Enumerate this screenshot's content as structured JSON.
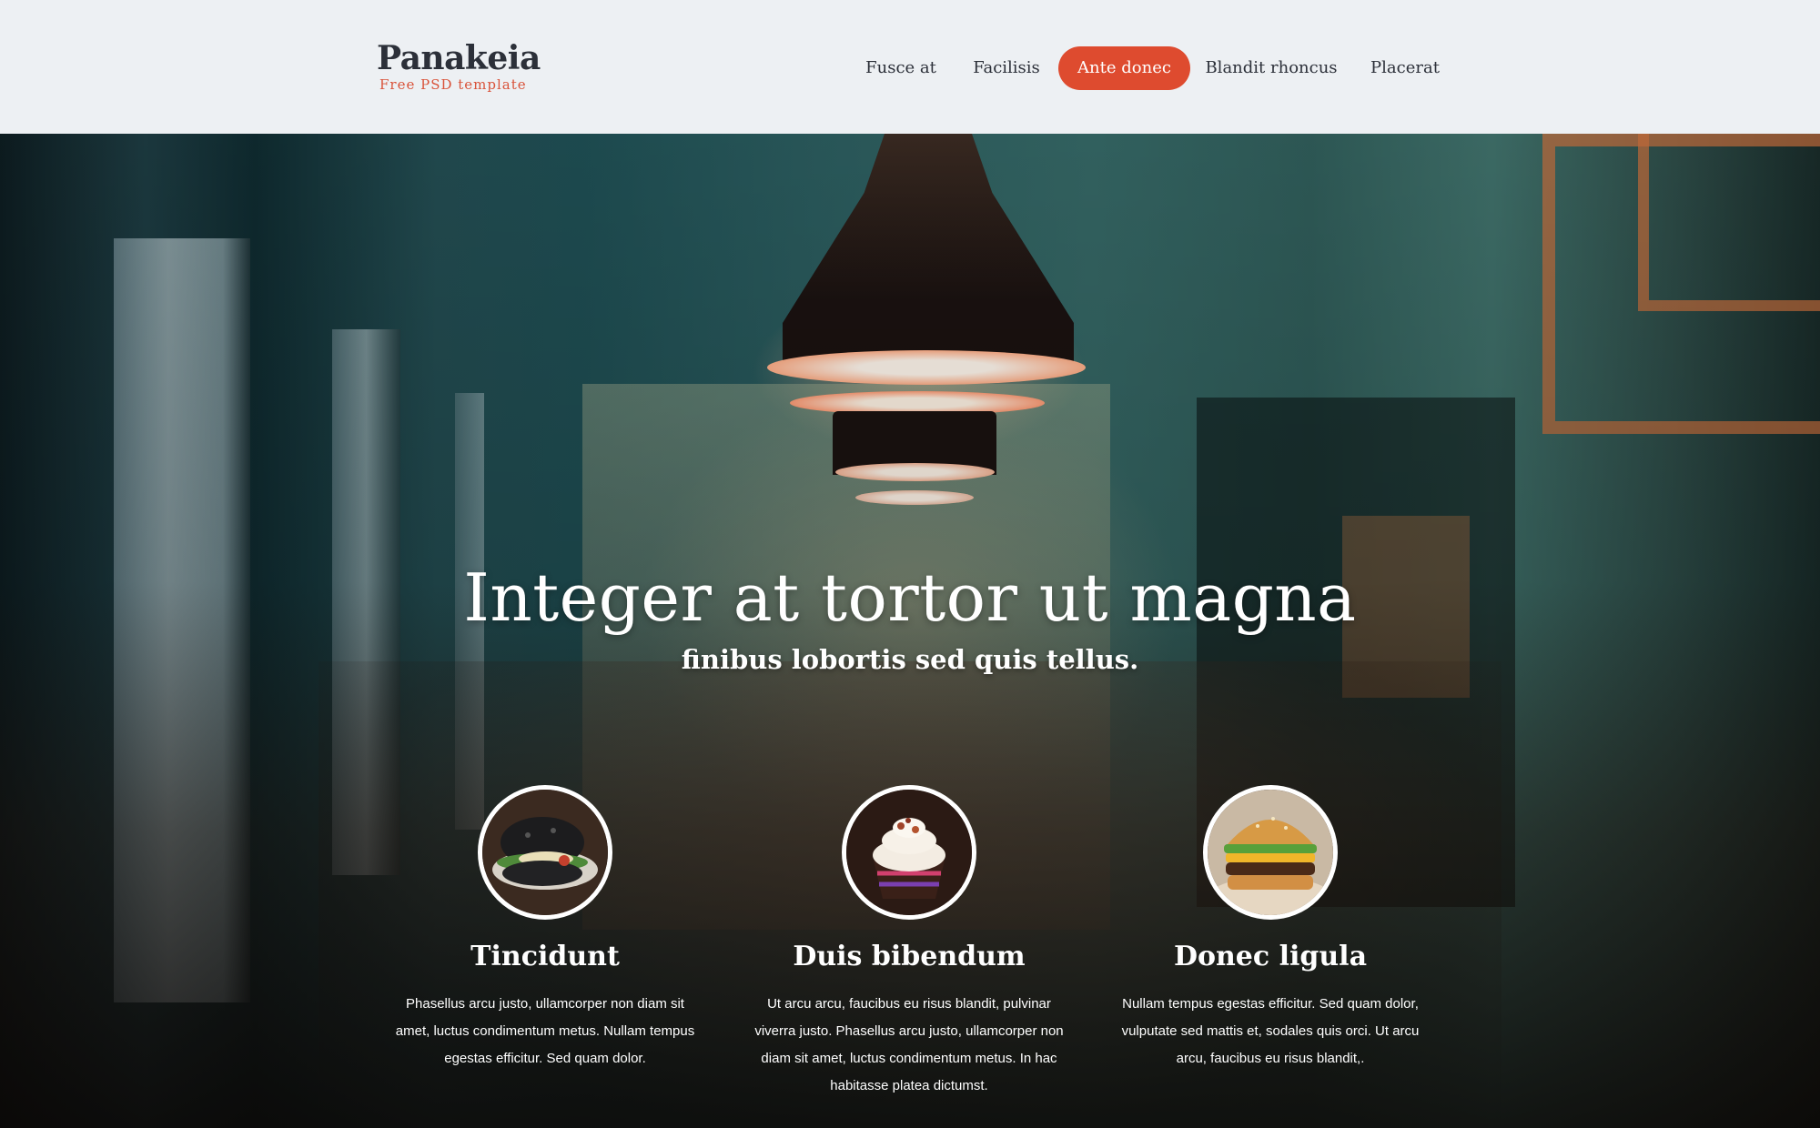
{
  "brand": {
    "name": "Panakeia",
    "tagline": "Free PSD template"
  },
  "nav": {
    "items": [
      {
        "label": "Fusce at",
        "active": false
      },
      {
        "label": "Facilisis",
        "active": false
      },
      {
        "label": "Ante donec",
        "active": true
      },
      {
        "label": "Blandit rhoncus",
        "active": false
      },
      {
        "label": "Placerat",
        "active": false
      }
    ]
  },
  "hero": {
    "title": "Integer at tortor ut magna",
    "subtitle": "finibus lobortis sed quis tellus."
  },
  "features": [
    {
      "title": "Tincidunt",
      "text": "Phasellus arcu justo, ullamcorper non diam sit amet, luctus condimentum metus. Nullam tempus egestas efficitur. Sed quam dolor.",
      "image": "black-burger-image"
    },
    {
      "title": "Duis bibendum",
      "text": "Ut arcu arcu, faucibus eu risus blandit, pulvinar viverra justo. Phasellus arcu justo, ullamcorper non diam sit amet, luctus condimentum metus. In hac habitasse platea dictumst.",
      "image": "cupcake-image"
    },
    {
      "title": "Donec ligula",
      "text": "Nullam tempus egestas efficitur. Sed quam dolor, vulputate sed mattis et, sodales quis orci. Ut arcu arcu, faucibus eu risus blandit,.",
      "image": "burger-image"
    }
  ],
  "colors": {
    "accent": "#de4b2f",
    "header_bg": "#edf0f3",
    "text_dark": "#2c3039"
  }
}
